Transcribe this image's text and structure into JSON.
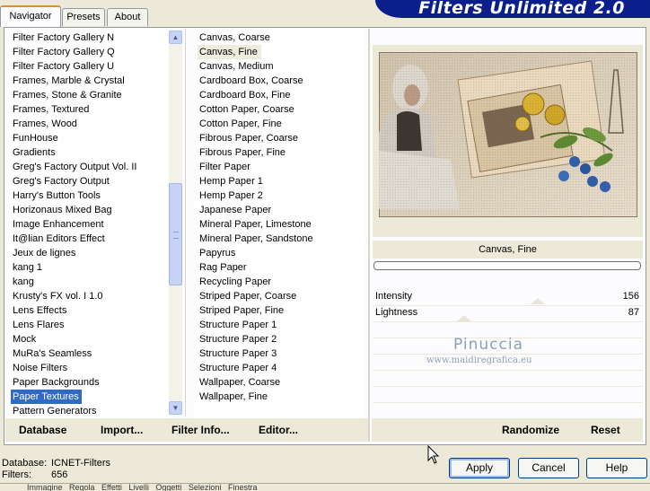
{
  "tabs": [
    {
      "label": "Navigator",
      "active": true
    },
    {
      "label": "Presets",
      "active": false
    },
    {
      "label": "About",
      "active": false
    }
  ],
  "brand": "Filters Unlimited 2.0",
  "categories": [
    "Filter Factory Gallery N",
    "Filter Factory Gallery Q",
    "Filter Factory Gallery U",
    "Frames, Marble & Crystal",
    "Frames, Stone & Granite",
    "Frames, Textured",
    "Frames, Wood",
    "FunHouse",
    "Gradients",
    "Greg's Factory Output Vol. II",
    "Greg's Factory Output",
    "Harry's Button Tools",
    "Horizonaus Mixed Bag",
    "Image Enhancement",
    "It@lian Editors Effect",
    "Jeux de lignes",
    "kang 1",
    "kang",
    "Krusty's FX vol. I 1.0",
    "Lens Effects",
    "Lens Flares",
    "Mock",
    "MuRa's Seamless",
    "Noise Filters",
    "Paper Backgrounds",
    "Paper Textures",
    "Pattern Generators"
  ],
  "selected_category": "Paper Textures",
  "filters": [
    "Canvas, Coarse",
    "Canvas, Fine",
    "Canvas, Medium",
    "Cardboard Box, Coarse",
    "Cardboard Box, Fine",
    "Cotton Paper, Coarse",
    "Cotton Paper, Fine",
    "Fibrous Paper, Coarse",
    "Fibrous Paper, Fine",
    "Filter Paper",
    "Hemp Paper 1",
    "Hemp Paper 2",
    "Japanese Paper",
    "Mineral Paper, Limestone",
    "Mineral Paper, Sandstone",
    "Papyrus",
    "Rag Paper",
    "Recycling Paper",
    "Striped Paper, Coarse",
    "Striped Paper, Fine",
    "Structure Paper 1",
    "Structure Paper 2",
    "Structure Paper 3",
    "Structure Paper 4",
    "Wallpaper, Coarse",
    "Wallpaper, Fine"
  ],
  "selected_filter": "Canvas, Fine",
  "current_filter_name": "Canvas, Fine",
  "params": [
    {
      "label": "Intensity",
      "value": "156",
      "level": 0.61
    },
    {
      "label": "Lightness",
      "value": "87",
      "level": 0.34
    }
  ],
  "watermark": {
    "line1": "Pinuccia",
    "line2": "www.maidiregrafica.eu"
  },
  "left_actions": {
    "database": "Database",
    "import": "Import...",
    "filter_info": "Filter Info...",
    "editor": "Editor..."
  },
  "right_actions": {
    "randomize": "Randomize",
    "reset": "Reset"
  },
  "status": {
    "database_label": "Database:",
    "database_value": "ICNET-Filters",
    "filters_label": "Filters:",
    "filters_value": "656"
  },
  "buttons": {
    "apply": "Apply",
    "cancel": "Cancel",
    "help": "Help"
  },
  "underbar_text": "Immagine   Regola   Effetti   Livelli   Oggetti   Selezioni   Finestra",
  "colors": {
    "selection": "#316ac5",
    "brand_bar": "#0a1f8c",
    "tab_accent": "#e68b2c"
  }
}
